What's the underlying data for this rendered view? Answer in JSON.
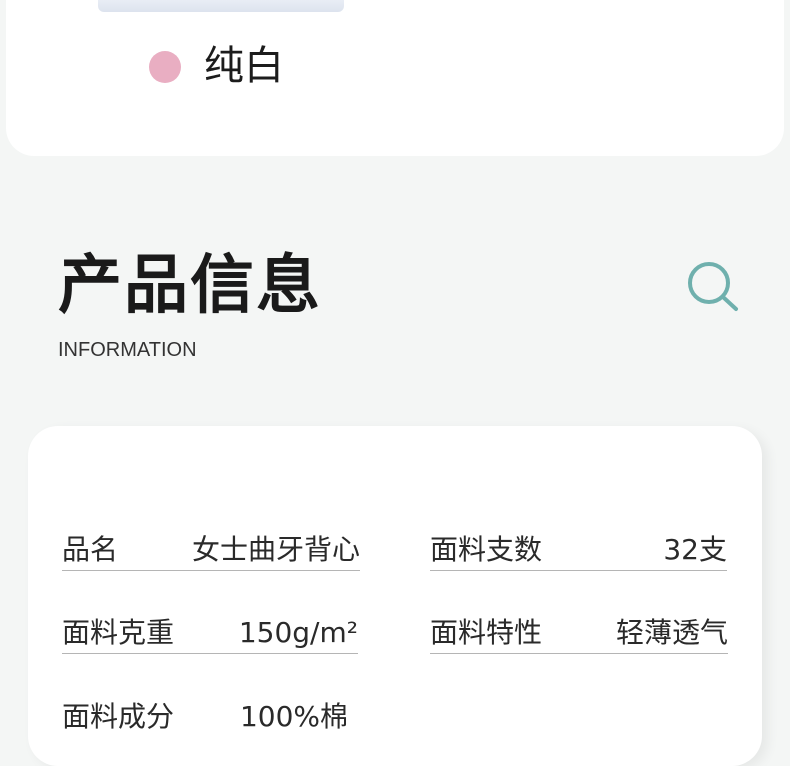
{
  "color_option": {
    "label": "纯白",
    "swatch_color": "#e9aec2"
  },
  "section": {
    "title": "产品信息",
    "subtitle": "INFORMATION",
    "icon": "search-icon",
    "icon_color": "#6fb0ad"
  },
  "specs": [
    {
      "key": "品名",
      "value": "女士曲牙背心"
    },
    {
      "key": "面料支数",
      "value": "32支"
    },
    {
      "key": "面料克重",
      "value": "150g/m²"
    },
    {
      "key": "面料特性",
      "value": "轻薄透气"
    },
    {
      "key": "面料成分",
      "value": "100%棉"
    }
  ]
}
